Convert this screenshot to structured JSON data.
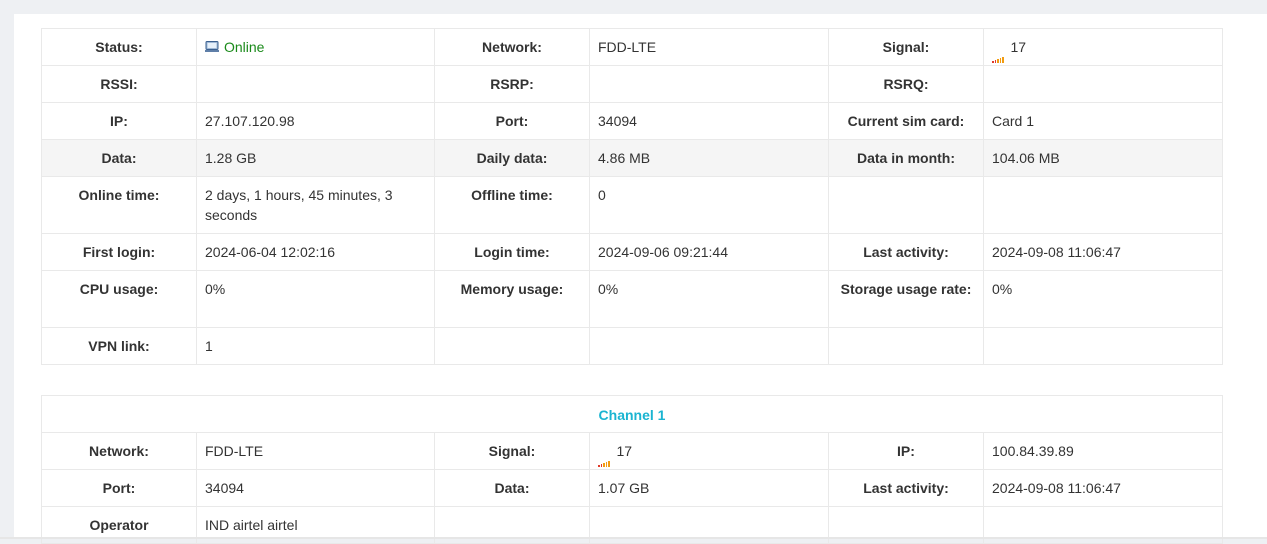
{
  "colors": {
    "online": "#1a8a1a",
    "channel_title": "#1ab4d1",
    "signal_low": "#e03a2a",
    "signal_mid": "#f29c11"
  },
  "status_table": {
    "r1": {
      "status_label": "Status:",
      "status_value": "Online",
      "status_icon": "computer-icon",
      "network_label": "Network:",
      "network_value": "FDD-LTE",
      "signal_label": "Signal:",
      "signal_value": "17",
      "signal_icon": "signal-bars-icon"
    },
    "r2": {
      "rssi_label": "RSSI:",
      "rsrp_label": "RSRP:",
      "rsrq_label": "RSRQ:"
    },
    "r3": {
      "ip_label": "IP:",
      "ip_value": "27.107.120.98",
      "port_label": "Port:",
      "port_value": "34094",
      "sim_label": "Current sim card:",
      "sim_value": "Card 1"
    },
    "r4": {
      "data_label": "Data:",
      "data_value": "1.28 GB",
      "daily_label": "Daily data:",
      "daily_value": "4.86 MB",
      "month_label": "Data in month:",
      "month_value": "104.06 MB"
    },
    "r5": {
      "online_time_label": "Online time:",
      "online_time_value": "2 days, 1 hours, 45 minutes, 3 seconds",
      "offline_time_label": "Offline time:",
      "offline_time_value": "0"
    },
    "r6": {
      "first_login_label": "First login:",
      "first_login_value": "2024-06-04 12:02:16",
      "login_time_label": "Login time:",
      "login_time_value": "2024-09-06 09:21:44",
      "last_activity_label": "Last activity:",
      "last_activity_value": "2024-09-08 11:06:47"
    },
    "r7": {
      "cpu_label": "CPU usage:",
      "cpu_value": "0%",
      "memory_label": "Memory usage:",
      "memory_value": "0%",
      "storage_label": "Storage usage rate:",
      "storage_value": "0%"
    },
    "r8": {
      "vpn_label": "VPN link:",
      "vpn_value": "1"
    }
  },
  "channel_table": {
    "title": "Channel 1",
    "r1": {
      "network_label": "Network:",
      "network_value": "FDD-LTE",
      "signal_label": "Signal:",
      "signal_value": "17",
      "ip_label": "IP:",
      "ip_value": "100.84.39.89"
    },
    "r2": {
      "port_label": "Port:",
      "port_value": "34094",
      "data_label": "Data:",
      "data_value": "1.07 GB",
      "last_activity_label": "Last activity:",
      "last_activity_value": "2024-09-08 11:06:47"
    },
    "r3": {
      "operator_label": "Operator",
      "operator_value": "IND airtel airtel"
    }
  }
}
